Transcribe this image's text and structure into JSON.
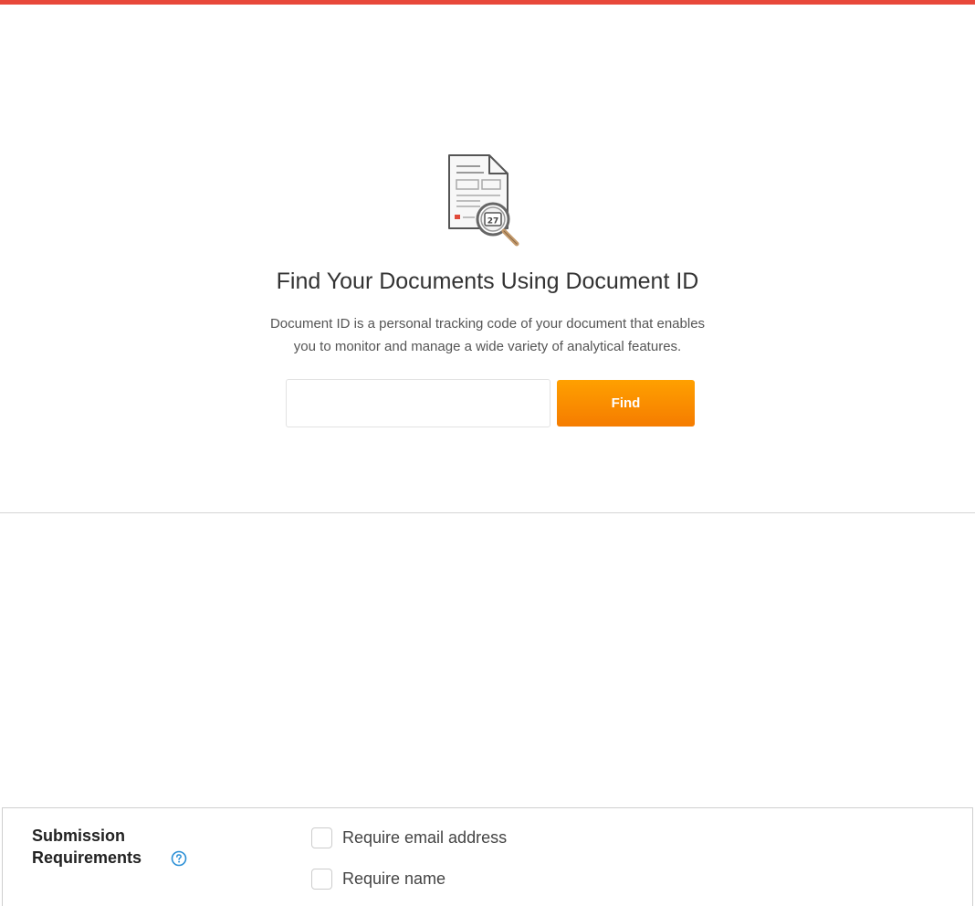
{
  "find_section": {
    "illustration_icon": "document-magnifier-icon",
    "badge_number": "27",
    "title": "Find Your Documents Using Document ID",
    "description_line1": "Document ID is a personal tracking code of your document that enables",
    "description_line2": "you to monitor and manage a wide variety of analytical features.",
    "input_value": "",
    "input_placeholder": "",
    "find_label": "Find"
  },
  "submission": {
    "label_line1": "Submission",
    "label_line2": "Requirements",
    "help_icon": "question-circle-icon",
    "options": [
      {
        "label": "Require email address",
        "checked": false
      },
      {
        "label": "Require name",
        "checked": false
      }
    ]
  },
  "colors": {
    "accent_bar": "#e8483a",
    "find_button": "#f58a00",
    "help_icon": "#2a8fd6"
  }
}
